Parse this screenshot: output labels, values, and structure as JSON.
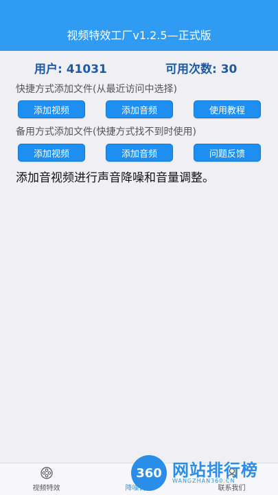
{
  "header": {
    "title": "视频特效工厂v1.2.5—正式版"
  },
  "stats": {
    "users": "用户: 41031",
    "remaining": "可用次数: 30"
  },
  "shortcut": {
    "label": "快捷方式添加文件(从最近访问中选择)",
    "buttons": [
      "添加视频",
      "添加音频",
      "使用教程"
    ]
  },
  "backup": {
    "label": "备用方式添加文件(快捷方式找不到时使用)",
    "buttons": [
      "添加视频",
      "添加音频",
      "问题反馈"
    ]
  },
  "description": "添加音视频进行声音降噪和音量调整。",
  "tabbar": {
    "tabs": [
      {
        "label": "视频特效",
        "icon": "film-reel-icon"
      },
      {
        "label": "降噪调音",
        "icon": "audio-icon"
      },
      {
        "label": "联系我们",
        "icon": "contact-icon"
      }
    ],
    "active_color": "#2f9bf3"
  },
  "watermark": {
    "logo": "360",
    "title": "网站排行榜",
    "subtitle": "WANGZHAN360.CN"
  },
  "colors": {
    "primary": "#2f9bf3",
    "button": "#1e8ff0",
    "stat_text": "#1c5aa6"
  }
}
